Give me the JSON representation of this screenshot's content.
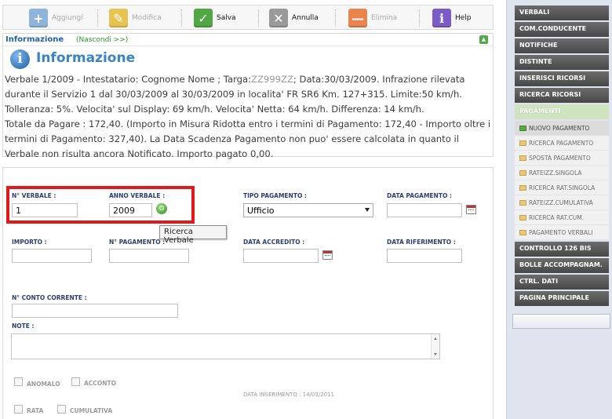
{
  "toolbar": {
    "buttons": [
      {
        "label": "Aggiungi",
        "icon": "add-icon",
        "enabled": false,
        "color": "#8fb4dc"
      },
      {
        "label": "Modifica",
        "icon": "edit-icon",
        "enabled": false,
        "color": "#e7c34f"
      },
      {
        "label": "Salva",
        "icon": "check-icon",
        "enabled": true,
        "color": "#4fa842"
      },
      {
        "label": "Annulla",
        "icon": "cancel-document-icon",
        "enabled": true,
        "color": "#9a9a9a"
      },
      {
        "label": "Elimina",
        "icon": "minus-icon",
        "enabled": false,
        "color": "#e9844d"
      },
      {
        "label": "Help",
        "icon": "info-icon",
        "enabled": true,
        "color": "#7a5bc9"
      }
    ]
  },
  "info": {
    "header_title": "Informazione",
    "hide_link": "(Nascondi >>)",
    "title": "Informazione",
    "text_part1": "Verbale 1/2009 - Intestatario:  Cognome Nome               ; Targa:",
    "plate": "ZZ999ZZ",
    "text_part2": "; Data:30/03/2009. Infrazione rilevata durante il Servizio 1 dal 30/03/2009 al 30/03/2009 in localita' FR SR6 Km. 127+315. Limite:50 km/h. Tolleranza: 5%. Velocita' sul Display: 69 km/h. Velocita' Netta: 64 km/h. Differenza: 14 km/h.\nTotale da Pagare : 172,40. (Importo in Misura Ridotta entro i termini di Pagamento: 172,40 - Importo oltre i termini di Pagamento: 327,40). La Data Scadenza Pagamento non puo' essere calcolata in quanto il Verbale non risulta ancora Notificato. Importo pagato 0,00."
  },
  "form": {
    "n_verbale_label": "N° VERBALE :",
    "n_verbale_value": "1",
    "anno_verbale_label": "ANNO VERBALE :",
    "anno_verbale_value": "2009",
    "tipo_pagamento_label": "TIPO PAGAMENTO :",
    "tipo_pagamento_value": "Ufficio",
    "data_pagamento_label": "DATA PAGAMENTO :",
    "importo_label": "IMPORTO :",
    "n_pagamento_label": "N° PAGAMENTO :",
    "data_accredito_label": "DATA ACCREDITO :",
    "data_riferimento_label": "DATA RIFERIMENTO :",
    "conto_corrente_label": "N° CONTO CORRENTE :",
    "note_label": "NOTE :",
    "anomalo_label": "ANOMALO",
    "acconto_label": "ACCONTO",
    "rata_label": "RATA",
    "cumulativa_label": "CUMULATIVA",
    "inserted_label": "DATA INSERIMENTO : 14/03/2011",
    "tooltip": "Ricerca Verbale"
  },
  "menu": {
    "top_items": [
      "VERBALI",
      "COM.CONDUCENTE",
      "NOTIFICHE",
      "DISTINTE",
      "INSERISCI RICORSI",
      "RICERCA RICORSI"
    ],
    "group": "PAGAMENTI",
    "sub_items": [
      "NUOVO PAGAMENTO",
      "RICERCA PAGAMENTO",
      "SPOSTA PAGAMENTO",
      "RATEIZZ.SINGOLA",
      "RICERCA RAT.SINGOLA",
      "RATEIZZ.CUMULATIVA",
      "RICERCA RAT.CUM.",
      "PAGAMENTO VERBALI"
    ],
    "bottom_items": [
      "CONTROLLO 126 BIS",
      "BOLLE ACCOMPAGNAM.",
      "CTRL. DATI",
      "PAGINA PRINCIPALE"
    ]
  },
  "colors": {
    "highlight": "#e01a1a",
    "menu_dark": "#555555",
    "group_bg": "#cfe3bf",
    "active_square": "#5aa745"
  }
}
